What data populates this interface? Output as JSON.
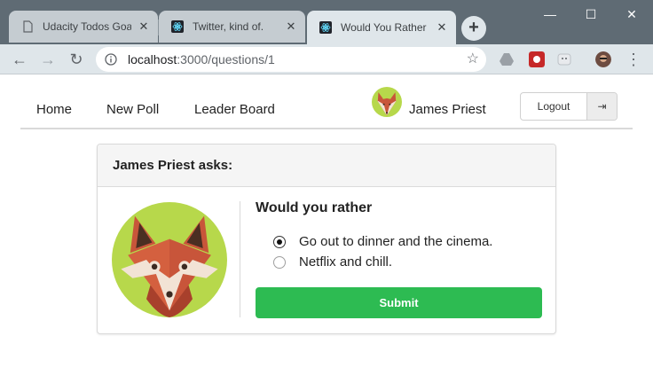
{
  "browser": {
    "tabs": [
      {
        "title": "Udacity Todos Goal",
        "close": "✕"
      },
      {
        "title": "Twitter, kind of.",
        "close": "✕"
      },
      {
        "title": "Would You Rather C",
        "close": "✕"
      }
    ],
    "new_tab": "+",
    "window_controls": {
      "minimize": "—",
      "maximize": "☐",
      "close": "✕"
    },
    "nav": {
      "back": "←",
      "forward": "→",
      "reload": "↻"
    },
    "url_host": "localhost",
    "url_path": ":3000/questions/1",
    "star": "☆",
    "menu": "⋮"
  },
  "app": {
    "nav": {
      "home": "Home",
      "new_poll": "New Poll",
      "leader_board": "Leader Board",
      "user_name": "James Priest",
      "logout": "Logout",
      "logout_icon": "⇥"
    },
    "card": {
      "header": "James Priest asks:",
      "question_title": "Would you rather",
      "options": [
        {
          "text": "Go out to dinner and the cinema.",
          "selected": true
        },
        {
          "text": "Netflix and chill.",
          "selected": false
        }
      ],
      "submit": "Submit"
    },
    "colors": {
      "accent": "#2dbb52",
      "chrome_dark": "#5f6b74",
      "chrome_light": "#dfe6ea",
      "fox_orange": "#c8553a",
      "avatar_bg": "#b7d84b"
    }
  }
}
